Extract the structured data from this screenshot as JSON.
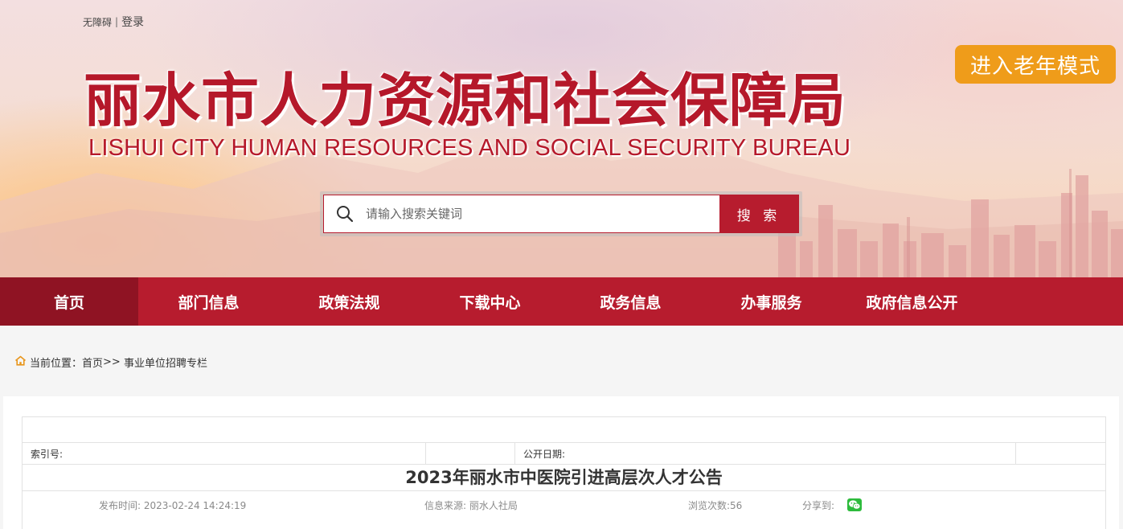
{
  "header": {
    "accessibility_label": "无障碍",
    "separator": "|",
    "login_label": "登录",
    "elder_mode_label": "进入老年模式",
    "title_cn": "丽水市人力资源和社会保障局",
    "title_en": "LISHUI CITY HUMAN RESOURCES AND SOCIAL SECURITY BUREAU",
    "search_placeholder": "请输入搜索关键词",
    "search_button_label": "搜 索"
  },
  "nav": {
    "items": [
      {
        "label": "首页",
        "active": true
      },
      {
        "label": "部门信息"
      },
      {
        "label": "政策法规"
      },
      {
        "label": "下载中心"
      },
      {
        "label": "政务信息"
      },
      {
        "label": "办事服务"
      },
      {
        "label": "政府信息公开"
      }
    ]
  },
  "breadcrumb": {
    "prefix": "当前位置：",
    "home": "首页",
    "sep": ">>",
    "current": "事业单位招聘专栏"
  },
  "article": {
    "index_label": "索引号:",
    "index_value": "",
    "publish_date_label": "公开日期:",
    "publish_date_value": "",
    "title": "2023年丽水市中医院引进高层次人才公告",
    "publish_time": "发布时间: 2023-02-24 14:24:19",
    "source": "信息来源: 丽水人社局",
    "views": "浏览次数:56",
    "share_label": "分享到:"
  },
  "colors": {
    "brand_red": "#b71c2e",
    "nav_active": "#8f1323",
    "elder_orange": "#ef9c1a",
    "wechat_green": "#2dbb3c"
  },
  "icons": [
    "search-icon",
    "home-icon",
    "wechat-icon"
  ]
}
